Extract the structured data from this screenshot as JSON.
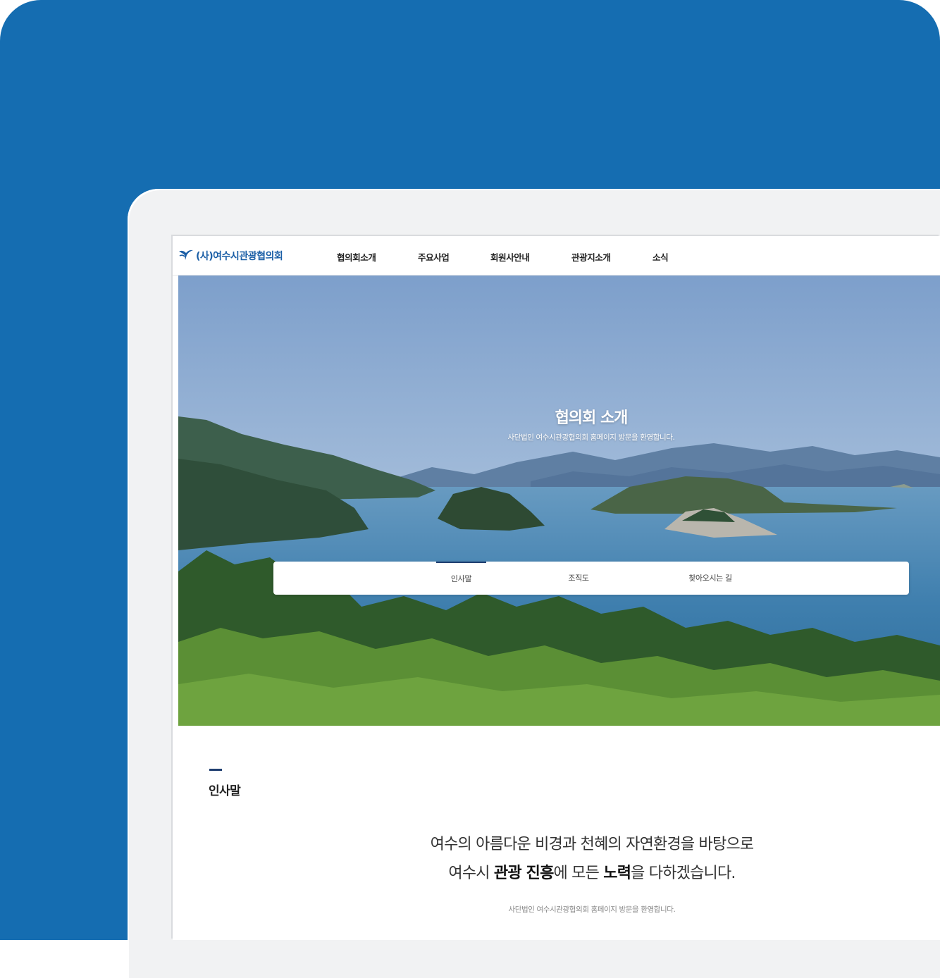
{
  "brand": {
    "name": "(사)여수시관광협의회",
    "icon": "seagull-logo-icon",
    "color": "#1a5ea6"
  },
  "nav": [
    "협의회소개",
    "주요사업",
    "회원사안내",
    "관광지소개",
    "소식"
  ],
  "hero": {
    "title": "협의회 소개",
    "subtitle": "사단법인 여수시관광협의회 홈페이지 방문을 환영합니다."
  },
  "subnav": {
    "tabs": [
      "인사말",
      "조직도",
      "찾아오시는 길"
    ],
    "active": "인사말"
  },
  "section": {
    "title": "인사말",
    "greeting_line1": "여수의 아름다운 비경과 천혜의 자연환경을 바탕으로",
    "greeting_line2_pre": "여수시 ",
    "greeting_line2_bold1": "관광 진흥",
    "greeting_line2_mid": "에 모든 ",
    "greeting_line2_bold2": "노력",
    "greeting_line2_post": "을 다하겠습니다.",
    "note": "사단법인 여수시관광협의회 홈페이지 방문을 환영합니다."
  },
  "colors": {
    "backdrop": "#156db1",
    "accent": "#1f3e70"
  }
}
